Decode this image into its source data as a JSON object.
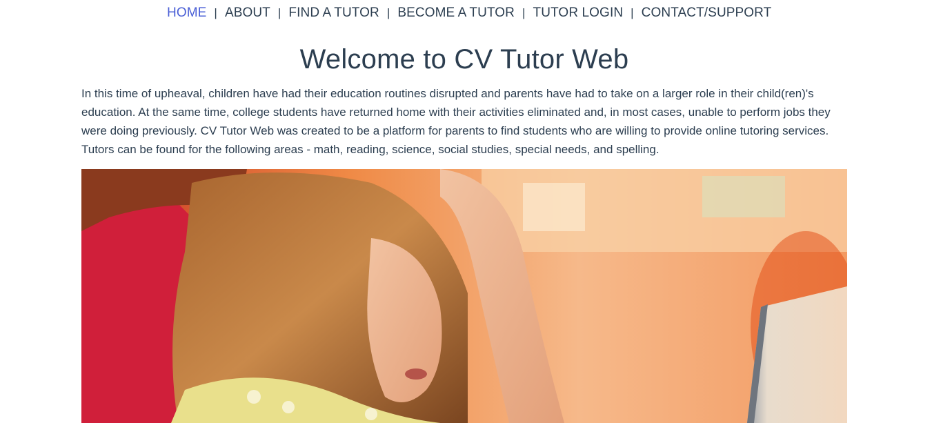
{
  "nav": {
    "items": [
      {
        "label": "HOME",
        "active": true
      },
      {
        "label": "ABOUT",
        "active": false
      },
      {
        "label": "FIND A TUTOR",
        "active": false
      },
      {
        "label": "BECOME A TUTOR",
        "active": false
      },
      {
        "label": "TUTOR LOGIN",
        "active": false
      },
      {
        "label": "CONTACT/SUPPORT",
        "active": false
      }
    ],
    "separator": "|"
  },
  "main": {
    "title": "Welcome to CV Tutor Web",
    "intro": "In this time of upheaval, children have had their education routines disrupted and parents have had to take on a larger role in their child(ren)'s education. At the same time, college students have returned home with their activities eliminated and, in most cases, unable to perform jobs they were doing previously. CV Tutor Web was created to be a platform for parents to find students who are willing to provide online tutoring services. Tutors can be found for the following areas - math, reading, science, social studies, special needs, and spelling."
  },
  "colors": {
    "text": "#2c3e50",
    "nav_active": "#4a5fd6",
    "background": "#ffffff"
  }
}
